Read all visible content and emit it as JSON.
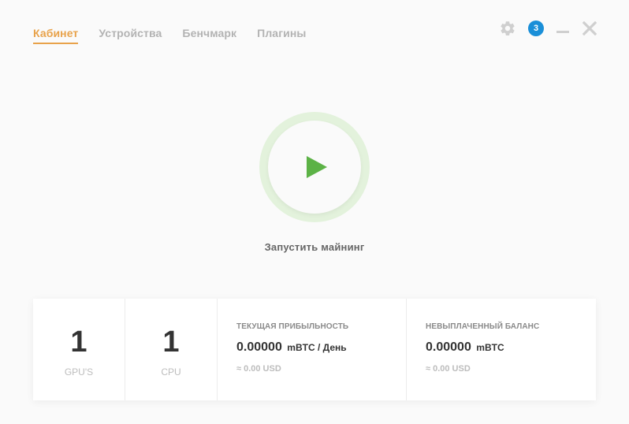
{
  "nav": {
    "items": [
      {
        "label": "Кабинет",
        "active": true
      },
      {
        "label": "Устройства",
        "active": false
      },
      {
        "label": "Бенчмарк",
        "active": false
      },
      {
        "label": "Плагины",
        "active": false
      }
    ]
  },
  "controls": {
    "notifications_count": "3",
    "gear_icon": "gear-icon",
    "minimize_icon": "minimize-icon",
    "close_icon": "close-icon"
  },
  "mining": {
    "start_label": "Запустить майнинг",
    "play_icon": "play-icon",
    "ring_color": "#e3f2dc",
    "play_color": "#5cb246"
  },
  "stats": {
    "gpus": {
      "value": "1",
      "label": "GPU'S"
    },
    "cpu": {
      "value": "1",
      "label": "CPU"
    },
    "profit": {
      "title": "ТЕКУЩАЯ ПРИБЫЛЬНОСТЬ",
      "value": "0.00000",
      "unit": "mBTC / День",
      "usd": "≈ 0.00 USD"
    },
    "balance": {
      "title": "НЕВЫПЛАЧЕННЫЙ БАЛАНС",
      "value": "0.00000",
      "unit": "mBTC",
      "usd": "≈ 0.00 USD"
    }
  },
  "colors": {
    "accent": "#e8a24a",
    "badge": "#1a8fd8"
  }
}
